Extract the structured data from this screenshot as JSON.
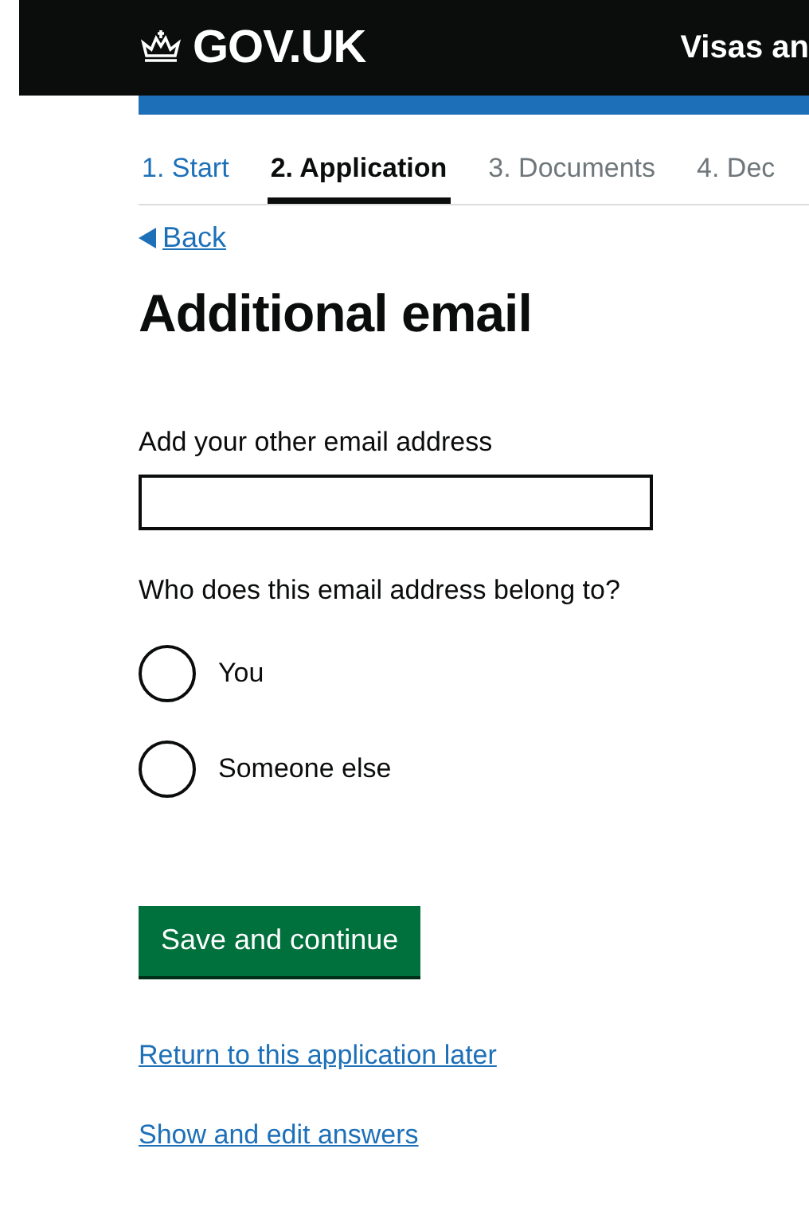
{
  "header": {
    "logo": "GOV.UK",
    "service": "Visas an"
  },
  "steps": [
    {
      "label": "1. Start",
      "disabled": false,
      "selected": false
    },
    {
      "label": "2. Application",
      "disabled": false,
      "selected": true
    },
    {
      "label": "3. Documents",
      "disabled": true,
      "selected": false
    },
    {
      "label": "4. Dec",
      "disabled": true,
      "selected": false
    }
  ],
  "back_link": "Back",
  "heading": "Additional email",
  "email_field": {
    "label": "Add your other email address"
  },
  "question": "Who does this email address belong to?",
  "options": [
    {
      "label": "You",
      "selected": false
    },
    {
      "label": "Someone else",
      "selected": false
    }
  ],
  "primary_button": "Save and continue",
  "links": [
    "Return to this application later",
    "Show and edit answers"
  ]
}
